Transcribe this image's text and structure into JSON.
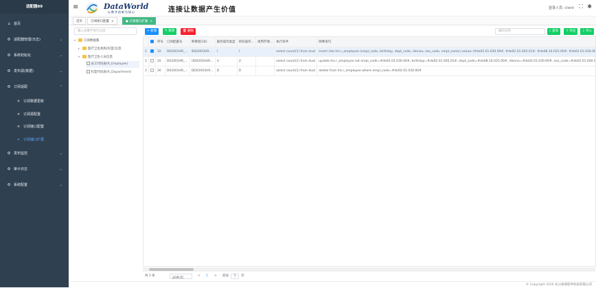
{
  "sidebar": {
    "title": "适配器89",
    "items": [
      {
        "label": "首页",
        "icon": "home-icon"
      },
      {
        "label": "适配器管理(日志)",
        "icon": "gear-icon"
      },
      {
        "label": "系统初始化",
        "icon": "gear-icon"
      },
      {
        "label": "发布源(数据)",
        "icon": "gear-icon"
      },
      {
        "label": "订阅适配",
        "icon": "gear-icon"
      },
      {
        "label": "订阅数据更新",
        "icon": "tool-icon"
      },
      {
        "label": "订阅源配置",
        "icon": "tool-icon"
      },
      {
        "label": "订阅接口配置",
        "icon": "tool-icon"
      },
      {
        "label": "订阅接口扩展",
        "icon": "tool-icon"
      },
      {
        "label": "发布监控",
        "icon": "gear-icon"
      },
      {
        "label": "审计日志",
        "icon": "gear-icon"
      },
      {
        "label": "系统配置",
        "icon": "gear-icon"
      }
    ]
  },
  "header": {
    "brand_name": "DataWorld",
    "brand_sub": "以数字创新为核心",
    "slogan": "连接让数据产生价值",
    "user_label": "登录人员: client",
    "fullscreen_icon": "expand-icon",
    "settings_icon": "gear-icon"
  },
  "tabs": [
    {
      "label": "首页"
    },
    {
      "label": "订阅接口配置"
    },
    {
      "label": "订阅接口扩展"
    }
  ],
  "tree": {
    "search_placeholder": "输入关键字进行过滤",
    "nodes": [
      {
        "label": "订阅数据集"
      },
      {
        "label": "医疗卫生机构(科室)信息"
      },
      {
        "label": "医疗卫生人员信息"
      },
      {
        "label": "员工代码表(R_Employee)"
      },
      {
        "label": "科室代码表(R_Department)"
      }
    ]
  },
  "toolbar": {
    "add": "新增",
    "edit": "修改",
    "delete": "删除",
    "search_placeholder": "编码名称",
    "query": "查询",
    "export": "导出",
    "import": "导入"
  },
  "grid": {
    "columns": [
      "序号",
      "订阅配置号",
      "映像接口ID",
      "服务操作类型",
      "目标操作...",
      "调用存储...",
      "执行条件",
      "映像语句"
    ],
    "rows": [
      {
        "no": "1",
        "seq": "10",
        "config": "D02003HR_...",
        "iface": "ID02003HR...",
        "svc": "I",
        "target": "I",
        "proc": "",
        "cond": "select count(1) from dual",
        "sql": "insert into his.r_employee (empl_code, birthday, dept_code, idenno, sex_code, empl_name) values (#de02.01.030.00#, #de02.01.005.01#, #de08.10.025.00#, #de02.01.030.00#, #de02.01.040.00#, #de02.01.039.00#)",
        "selected": true
      },
      {
        "no": "2",
        "seq": "20",
        "config": "D02003HR_...",
        "iface": "UD02003HR...",
        "svc": "U",
        "target": "U",
        "proc": "",
        "cond": "select count(1) from dual",
        "sql": "update his.r_employee set empl_code=#de02.01.030.00#, birthday=#de02.01.005.01#, dept_code=#de08.10.025.00#, idenno=#de02.01.030.00#, sex_code=#de02.01.040.00#",
        "selected": false
      },
      {
        "no": "3",
        "seq": "30",
        "config": "D02003HR_...",
        "iface": "DD02003HR...",
        "svc": "D",
        "target": "D",
        "proc": "",
        "cond": "select count(1) from dual",
        "sql": "delete from his.r_employee where empl_code=#de02.01.030.00#",
        "selected": false
      }
    ]
  },
  "pager": {
    "total": "共 3 条",
    "page_size": "20条/页",
    "goto_label": "前往",
    "page": "1",
    "page_suffix": "页",
    "prev": "<",
    "next": ">"
  },
  "footer": "© Copyright 2016 长沙泰瑞软件科技有限公司"
}
